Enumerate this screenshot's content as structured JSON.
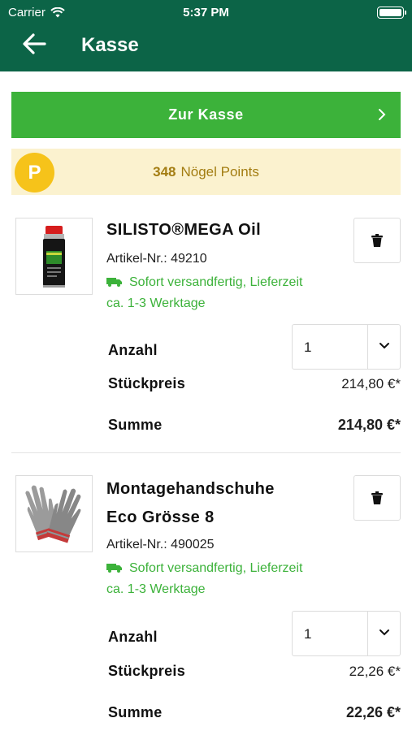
{
  "status_bar": {
    "carrier": "Carrier",
    "time": "5:37 PM"
  },
  "nav": {
    "title": "Kasse",
    "back_icon": "arrow-left-icon"
  },
  "checkout_button": {
    "label": "Zur Kasse"
  },
  "points": {
    "badge": "P",
    "value": "348",
    "label": "Nögel Points"
  },
  "items": [
    {
      "name_line1": "SILISTO®MEGA Oil",
      "name_line2": "",
      "article": "Artikel-Nr.: 49210",
      "shipping_line1": "Sofort versandfertig, Lieferzeit",
      "shipping_line2": "ca. 1-3 Werktage",
      "quantity_label": "Anzahl",
      "quantity": "1",
      "unit_price_label": "Stückpreis",
      "unit_price": "214,80 €*",
      "sum_label": "Summe",
      "sum": "214,80 €*"
    },
    {
      "name_line1": "Montagehandschuhe",
      "name_line2": "Eco Grösse 8",
      "article": "Artikel-Nr.: 490025",
      "shipping_line1": "Sofort versandfertig, Lieferzeit",
      "shipping_line2": "ca. 1-3 Werktage",
      "quantity_label": "Anzahl",
      "quantity": "1",
      "unit_price_label": "Stückpreis",
      "unit_price": "22,26 €*",
      "sum_label": "Summe",
      "sum": "22,26 €*"
    }
  ],
  "colors": {
    "header": "#0c6447",
    "accent_green": "#3cb23a",
    "points_bg": "#fbf2cf",
    "points_text": "#a37d12",
    "badge": "#f6c31a"
  }
}
